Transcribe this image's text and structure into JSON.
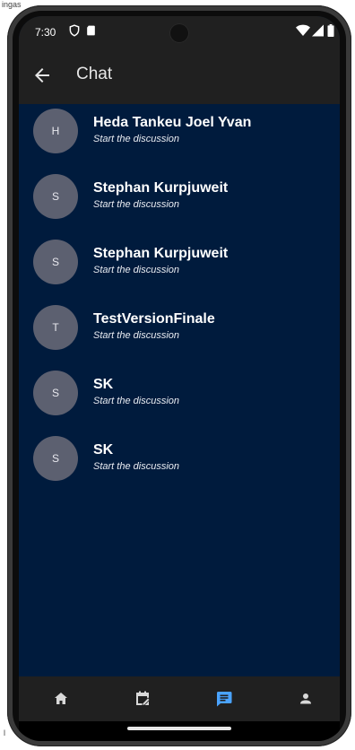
{
  "corner_text": "ingas",
  "corner_text2": "l",
  "status": {
    "time": "7:30"
  },
  "appbar": {
    "title": "Chat"
  },
  "chats": [
    {
      "initial": "H",
      "name": "Heda Tankeu Joel Yvan",
      "subtitle": "Start the discussion"
    },
    {
      "initial": "S",
      "name": "Stephan Kurpjuweit",
      "subtitle": "Start the discussion"
    },
    {
      "initial": "S",
      "name": "Stephan Kurpjuweit",
      "subtitle": "Start the discussion"
    },
    {
      "initial": "T",
      "name": "TestVersionFinale",
      "subtitle": "Start the discussion"
    },
    {
      "initial": "S",
      "name": "SK",
      "subtitle": "Start the discussion"
    },
    {
      "initial": "S",
      "name": "SK",
      "subtitle": "Start the discussion"
    }
  ],
  "nav": {
    "items": [
      "home-icon",
      "event-icon",
      "chat-icon",
      "person-icon"
    ],
    "active_index": 2
  },
  "colors": {
    "screen_bg": "#001b3d",
    "bar_bg": "#202020",
    "avatar_bg": "#5c6070",
    "nav_active": "#4aa3ff",
    "nav_inactive": "#d8d8d8"
  }
}
